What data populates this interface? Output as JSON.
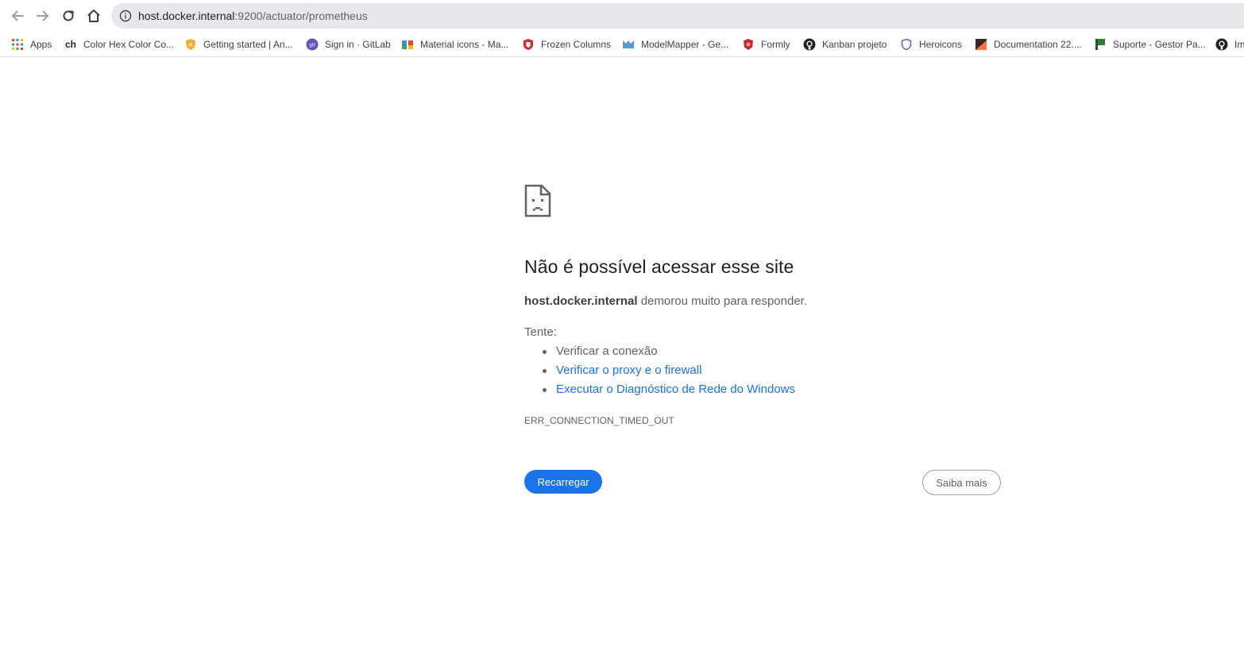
{
  "browser": {
    "url_host": "host.docker.internal",
    "url_path": ":9200/actuator/prometheus"
  },
  "bookmarks": [
    {
      "label": "Apps",
      "icon": "apps-grid-icon"
    },
    {
      "label": "Color Hex Color Co...",
      "icon": "colorhex-icon"
    },
    {
      "label": "Getting started | An...",
      "icon": "angular-shield-icon"
    },
    {
      "label": "Sign in · GitLab",
      "icon": "gitlab-icon"
    },
    {
      "label": "Material icons - Ma...",
      "icon": "material-icon"
    },
    {
      "label": "Frozen Columns",
      "icon": "primefaces-icon"
    },
    {
      "label": "ModelMapper - Ge...",
      "icon": "modelmapper-icon"
    },
    {
      "label": "Formly",
      "icon": "formly-icon"
    },
    {
      "label": "Kanban projeto",
      "icon": "github-icon"
    },
    {
      "label": "Heroicons",
      "icon": "heroicons-icon"
    },
    {
      "label": "Documentation 22....",
      "icon": "documentation-icon"
    },
    {
      "label": "Suporte - Gestor Pa...",
      "icon": "suporte-flag-icon"
    },
    {
      "label": "Im",
      "icon": "github-icon"
    }
  ],
  "error": {
    "title": "Não é possível acessar esse site",
    "host": "host.docker.internal",
    "message": " demorou muito para responder.",
    "try_label": "Tente:",
    "suggestions": [
      "Verificar a conexão",
      "Verificar o proxy e o firewall",
      "Executar o Diagnóstico de Rede do Windows"
    ],
    "code": "ERR_CONNECTION_TIMED_OUT",
    "reload_label": "Recarregar",
    "more_label": "Saiba mais"
  },
  "colors": {
    "accent": "#1a73e8",
    "text_primary": "#202124",
    "text_secondary": "#5f6368"
  }
}
